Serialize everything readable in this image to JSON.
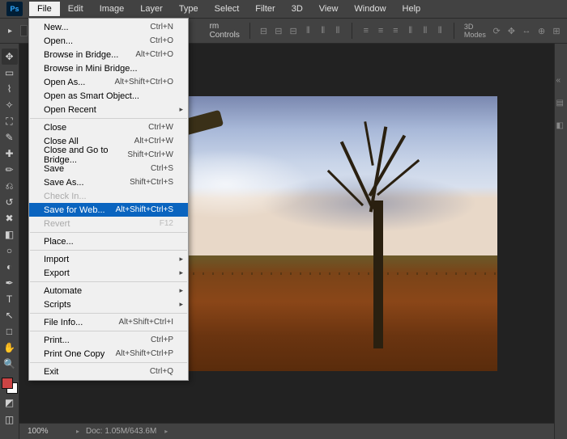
{
  "app": {
    "logo": "Ps"
  },
  "window_controls": {
    "min": "—",
    "max": "□",
    "close": "✕"
  },
  "menubar": [
    "File",
    "Edit",
    "Image",
    "Layer",
    "Type",
    "Select",
    "Filter",
    "3D",
    "View",
    "Window",
    "Help"
  ],
  "menubar_open_index": 0,
  "optionsbar": {
    "controls_label": "rm Controls",
    "modes_label": "3D Modes"
  },
  "file_menu": [
    {
      "label": "New...",
      "shortcut": "Ctrl+N"
    },
    {
      "label": "Open...",
      "shortcut": "Ctrl+O"
    },
    {
      "label": "Browse in Bridge...",
      "shortcut": "Alt+Ctrl+O"
    },
    {
      "label": "Browse in Mini Bridge..."
    },
    {
      "label": "Open As...",
      "shortcut": "Alt+Shift+Ctrl+O"
    },
    {
      "label": "Open as Smart Object..."
    },
    {
      "label": "Open Recent",
      "submenu": true
    },
    {
      "sep": true
    },
    {
      "label": "Close",
      "shortcut": "Ctrl+W"
    },
    {
      "label": "Close All",
      "shortcut": "Alt+Ctrl+W"
    },
    {
      "label": "Close and Go to Bridge...",
      "shortcut": "Shift+Ctrl+W"
    },
    {
      "label": "Save",
      "shortcut": "Ctrl+S"
    },
    {
      "label": "Save As...",
      "shortcut": "Shift+Ctrl+S"
    },
    {
      "label": "Check In...",
      "disabled": true
    },
    {
      "label": "Save for Web...",
      "shortcut": "Alt+Shift+Ctrl+S",
      "highlighted": true
    },
    {
      "label": "Revert",
      "shortcut": "F12",
      "disabled": true
    },
    {
      "sep": true
    },
    {
      "label": "Place..."
    },
    {
      "sep": true
    },
    {
      "label": "Import",
      "submenu": true
    },
    {
      "label": "Export",
      "submenu": true
    },
    {
      "sep": true
    },
    {
      "label": "Automate",
      "submenu": true
    },
    {
      "label": "Scripts",
      "submenu": true
    },
    {
      "sep": true
    },
    {
      "label": "File Info...",
      "shortcut": "Alt+Shift+Ctrl+I"
    },
    {
      "sep": true
    },
    {
      "label": "Print...",
      "shortcut": "Ctrl+P"
    },
    {
      "label": "Print One Copy",
      "shortcut": "Alt+Shift+Ctrl+P"
    },
    {
      "sep": true
    },
    {
      "label": "Exit",
      "shortcut": "Ctrl+Q"
    }
  ],
  "tools": [
    {
      "name": "move-tool",
      "glyph": "✥"
    },
    {
      "name": "marquee-tool",
      "glyph": "▭"
    },
    {
      "name": "lasso-tool",
      "glyph": "⌇"
    },
    {
      "name": "magic-wand-tool",
      "glyph": "✧"
    },
    {
      "name": "crop-tool",
      "glyph": "⛶"
    },
    {
      "name": "eyedropper-tool",
      "glyph": "✎"
    },
    {
      "name": "healing-brush-tool",
      "glyph": "✚"
    },
    {
      "name": "brush-tool",
      "glyph": "✏"
    },
    {
      "name": "clone-stamp-tool",
      "glyph": "⎌"
    },
    {
      "name": "history-brush-tool",
      "glyph": "↺"
    },
    {
      "name": "eraser-tool",
      "glyph": "✖"
    },
    {
      "name": "gradient-tool",
      "glyph": "◧"
    },
    {
      "name": "blur-tool",
      "glyph": "○"
    },
    {
      "name": "dodge-tool",
      "glyph": "◐"
    },
    {
      "name": "pen-tool",
      "glyph": "✒"
    },
    {
      "name": "type-tool",
      "glyph": "T"
    },
    {
      "name": "path-selection-tool",
      "glyph": "↖"
    },
    {
      "name": "shape-tool",
      "glyph": "□"
    },
    {
      "name": "hand-tool",
      "glyph": "✋"
    },
    {
      "name": "zoom-tool",
      "glyph": "🔍"
    }
  ],
  "status": {
    "zoom": "100%",
    "doc": "Doc: 1.05M/643.6M"
  }
}
